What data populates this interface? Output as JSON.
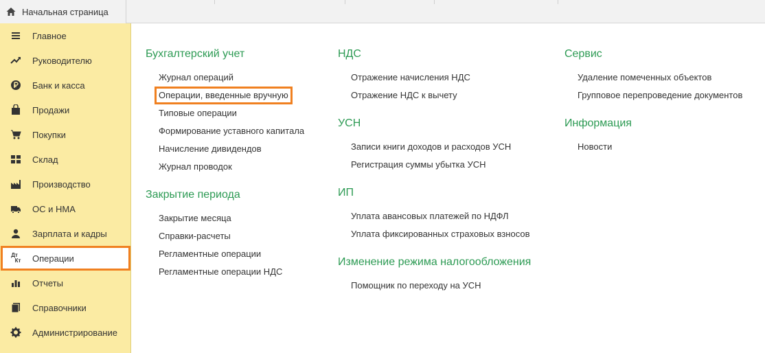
{
  "home_tab": {
    "label": "Начальная страница",
    "icon": "home-icon"
  },
  "sidebar": {
    "items": [
      {
        "label": "Главное",
        "icon": "menu-icon"
      },
      {
        "label": "Руководителю",
        "icon": "trend-icon"
      },
      {
        "label": "Банк и касса",
        "icon": "ruble-icon"
      },
      {
        "label": "Продажи",
        "icon": "bag-icon"
      },
      {
        "label": "Покупки",
        "icon": "cart-icon"
      },
      {
        "label": "Склад",
        "icon": "grid-icon"
      },
      {
        "label": "Производство",
        "icon": "factory-icon"
      },
      {
        "label": "ОС и НМА",
        "icon": "truck-icon"
      },
      {
        "label": "Зарплата и кадры",
        "icon": "person-icon"
      },
      {
        "label": "Операции",
        "icon": "dt-kt-icon",
        "active": true
      },
      {
        "label": "Отчеты",
        "icon": "bar-chart-icon"
      },
      {
        "label": "Справочники",
        "icon": "book-icon"
      },
      {
        "label": "Администрирование",
        "icon": "gear-icon"
      }
    ],
    "icon_glyph_dt": "Дт",
    "icon_glyph_kt": "Кт",
    "active_border_color": "#f08020",
    "background_color": "#fbeba3"
  },
  "sections": {
    "accounting": {
      "title": "Бухгалтерский учет",
      "links": [
        "Журнал операций",
        "Операции, введенные вручную",
        "Типовые операции",
        "Формирование уставного капитала",
        "Начисление дивидендов",
        "Журнал проводок"
      ]
    },
    "period_close": {
      "title": "Закрытие периода",
      "links": [
        "Закрытие месяца",
        "Справки-расчеты",
        "Регламентные операции",
        "Регламентные операции НДС"
      ]
    },
    "vat": {
      "title": "НДС",
      "links": [
        "Отражение начисления НДС",
        "Отражение НДС к вычету"
      ]
    },
    "usn": {
      "title": "УСН",
      "links": [
        "Записи книги доходов и расходов УСН",
        "Регистрация суммы убытка УСН"
      ]
    },
    "ip": {
      "title": "ИП",
      "links": [
        "Уплата авансовых платежей по НДФЛ",
        "Уплата фиксированных страховых взносов"
      ]
    },
    "tax_regime": {
      "title": "Изменение режима налогообложения",
      "links": [
        "Помощник по переходу на УСН"
      ]
    },
    "service": {
      "title": "Сервис",
      "links": [
        "Удаление помеченных объектов",
        "Групповое перепроведение документов"
      ]
    },
    "info": {
      "title": "Информация",
      "links": [
        "Новости"
      ]
    }
  },
  "colors": {
    "section_title": "#2c9a53",
    "highlight": "#f08020"
  }
}
